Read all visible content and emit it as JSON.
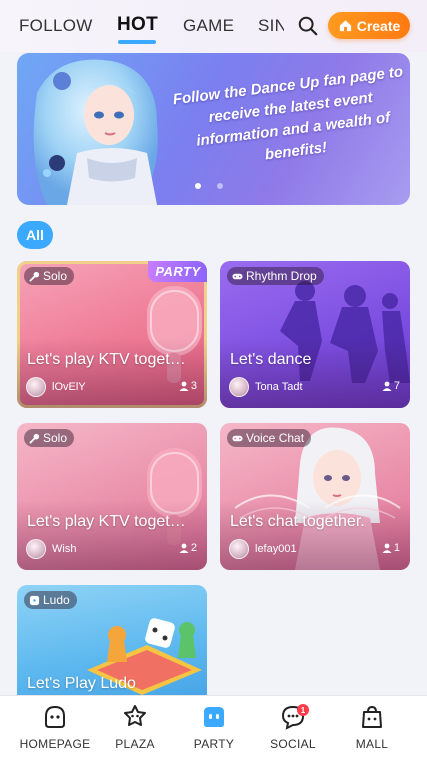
{
  "tabs": [
    {
      "label": "FOLLOW",
      "active": false
    },
    {
      "label": "HOT",
      "active": true
    },
    {
      "label": "GAME",
      "active": false
    },
    {
      "label": "SIN",
      "active": false
    }
  ],
  "create_button": {
    "label": "Create",
    "icon": "home-icon"
  },
  "search": {
    "icon": "search-icon"
  },
  "banner": {
    "text": "Follow the Dance Up fan page to receive the latest event information and a wealth of benefits!",
    "page_count": 2,
    "active_page": 1
  },
  "filter": {
    "label": "All"
  },
  "cards": [
    {
      "tag": "Solo",
      "tag_icon": "microphone-icon",
      "badge": "PARTY",
      "title": "Let's play KTV toget…",
      "user": "lOvElY",
      "count": "3"
    },
    {
      "tag": "Rhythm Drop",
      "tag_icon": "gamepad-icon",
      "badge": "",
      "title": "Let's dance",
      "user": "Tona Tadt",
      "count": "7"
    },
    {
      "tag": "Solo",
      "tag_icon": "microphone-icon",
      "badge": "",
      "title": "Let's play KTV toget…",
      "user": "Wish",
      "count": "2"
    },
    {
      "tag": "Voice Chat",
      "tag_icon": "gamepad-icon",
      "badge": "",
      "title": "Let's chat together.",
      "user": "lefay001",
      "count": "1"
    },
    {
      "tag": "Ludo",
      "tag_icon": "dice-icon",
      "badge": "",
      "title": "Let's Play Ludo",
      "user": "",
      "count": ""
    }
  ],
  "nav": [
    {
      "label": "HOMEPAGE",
      "icon": "homepage-icon",
      "active": false
    },
    {
      "label": "PLAZA",
      "icon": "plaza-icon",
      "active": false
    },
    {
      "label": "PARTY",
      "icon": "party-icon",
      "active": true
    },
    {
      "label": "SOCIAL",
      "icon": "social-icon",
      "active": false,
      "badge": "1"
    },
    {
      "label": "MALL",
      "icon": "mall-icon",
      "active": false
    }
  ],
  "colors": {
    "accent": "#3aa9ff",
    "create": "#ff8a1a",
    "badge": "#ff3b4a"
  }
}
